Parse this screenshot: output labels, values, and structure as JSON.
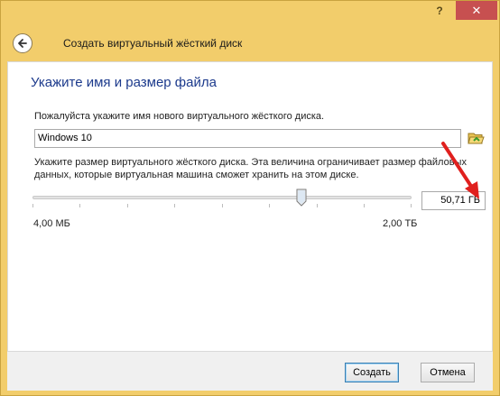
{
  "window": {
    "help_glyph": "?",
    "close_glyph": "✕"
  },
  "header": {
    "title": "Создать виртуальный жёсткий диск"
  },
  "main": {
    "section_title": "Укажите имя и размер файла",
    "name_description": "Пожалуйста укажите имя нового виртуального жёсткого диска.",
    "name_value": "Windows 10",
    "size_description": "Укажите размер виртуального жёсткого диска. Эта величина ограничивает размер файловых данных, которые виртуальная машина сможет хранить на этом диске.",
    "size_value": "50,71 ГБ",
    "slider_fraction": 0.71,
    "min_label": "4,00 МБ",
    "max_label": "2,00 ТБ"
  },
  "buttons": {
    "create": "Создать",
    "cancel": "Отмена"
  },
  "colors": {
    "title_accent": "#1c3a8c",
    "frame": "#f2cd6b",
    "close_button": "#c75050",
    "annotation_arrow": "#e0201e"
  },
  "icons": {
    "back": "back-arrow-icon",
    "folder": "folder-open-icon",
    "annotation": "red-arrow-icon"
  }
}
